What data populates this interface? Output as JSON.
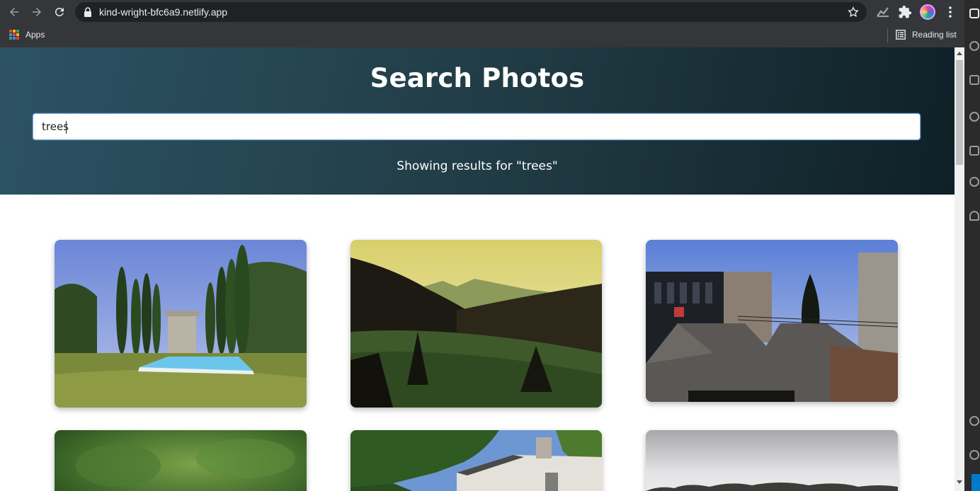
{
  "browser": {
    "url": "kind-wright-bfc6a9.netlify.app",
    "bookmarks": {
      "apps_label": "Apps",
      "reading_list_label": "Reading list"
    }
  },
  "page": {
    "title": "Search Photos",
    "search": {
      "value": "trees"
    },
    "results_prefix": "Showing results for ",
    "results_query": "\"trees\""
  },
  "photos": [
    {
      "subject": "cypress-pool"
    },
    {
      "subject": "green-hills"
    },
    {
      "subject": "buildings-tree"
    },
    {
      "subject": "blurred-foliage"
    },
    {
      "subject": "house-trees"
    },
    {
      "subject": "misty-treeline"
    }
  ]
}
